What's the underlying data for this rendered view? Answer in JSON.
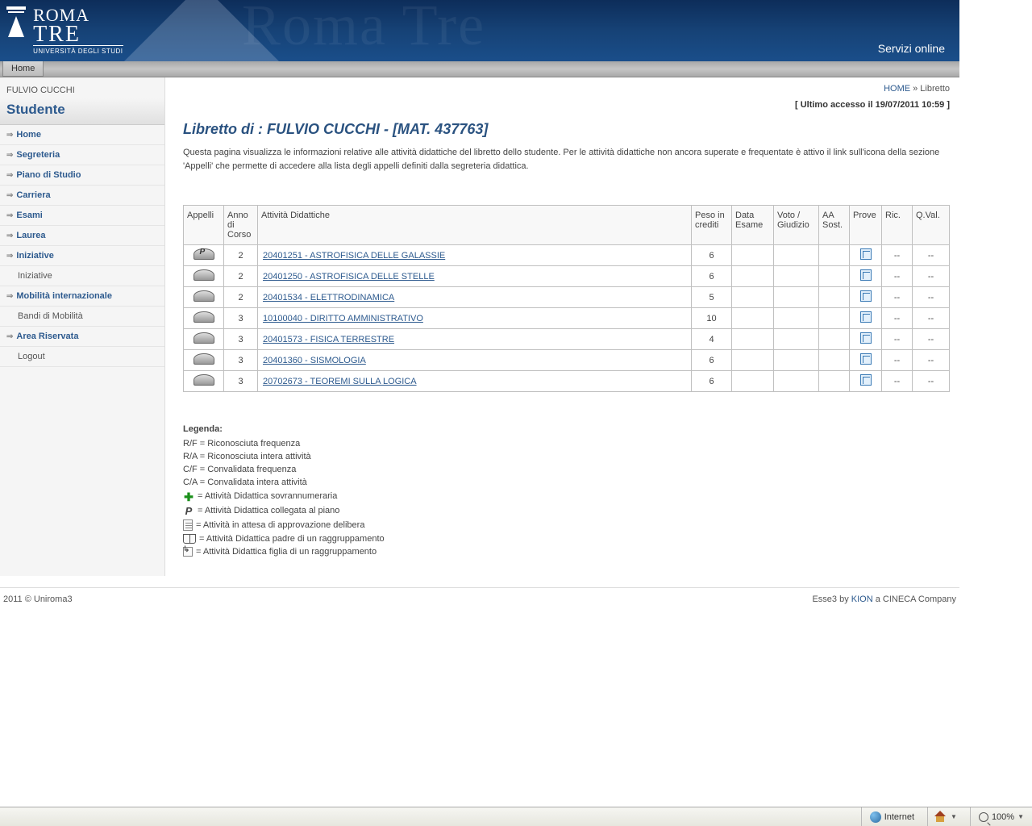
{
  "header": {
    "logo_top": "ROMA",
    "logo_bottom": "TRE",
    "logo_sub": "UNIVERSITÀ DEGLI STUDI",
    "watermark": "Roma Tre",
    "servizi": "Servizi online"
  },
  "topbar": {
    "home": "Home"
  },
  "sidebar": {
    "username": "FULVIO CUCCHI",
    "role": "Studente",
    "items": [
      {
        "label": "Home",
        "type": "main"
      },
      {
        "label": "Segreteria",
        "type": "main"
      },
      {
        "label": "Piano di Studio",
        "type": "main"
      },
      {
        "label": "Carriera",
        "type": "main"
      },
      {
        "label": "Esami",
        "type": "main"
      },
      {
        "label": "Laurea",
        "type": "main"
      },
      {
        "label": "Iniziative",
        "type": "main"
      },
      {
        "label": "Iniziative",
        "type": "sub"
      },
      {
        "label": "Mobilità internazionale",
        "type": "main"
      },
      {
        "label": "Bandi di Mobilità",
        "type": "sub"
      },
      {
        "label": "Area Riservata",
        "type": "main"
      },
      {
        "label": "Logout",
        "type": "sub"
      }
    ]
  },
  "breadcrumb": {
    "home": "HOME",
    "sep": " » ",
    "current": "Libretto"
  },
  "last_access": "[ Ultimo accesso il 19/07/2011 10:59 ]",
  "page_title": "Libretto di : FULVIO CUCCHI - [MAT. 437763]",
  "intro": "Questa pagina visualizza le informazioni relative alle attività didattiche del libretto dello studente. Per le attività didattiche non ancora superate e frequentate è attivo il link sull'icona della sezione 'Appelli' che permette di accedere alla lista degli appelli definiti dalla segreteria didattica.",
  "table": {
    "headers": {
      "appelli": "Appelli",
      "anno": "Anno di Corso",
      "attivita": "Attività Didattiche",
      "peso": "Peso in crediti",
      "data": "Data Esame",
      "voto": "Voto / Giudizio",
      "aa": "AA Sost.",
      "prove": "Prove",
      "ric": "Ric.",
      "qval": "Q.Val."
    },
    "rows": [
      {
        "anno": "2",
        "attivita": "20401251 - ASTROFISICA DELLE GALASSIE",
        "peso": "6",
        "ric": "--",
        "qval": "--",
        "p": true
      },
      {
        "anno": "2",
        "attivita": "20401250 - ASTROFISICA DELLE STELLE",
        "peso": "6",
        "ric": "--",
        "qval": "--",
        "p": false
      },
      {
        "anno": "2",
        "attivita": "20401534 - ELETTRODINAMICA",
        "peso": "5",
        "ric": "--",
        "qval": "--",
        "p": false
      },
      {
        "anno": "3",
        "attivita": "10100040 - DIRITTO AMMINISTRATIVO",
        "peso": "10",
        "ric": "--",
        "qval": "--",
        "p": false
      },
      {
        "anno": "3",
        "attivita": "20401573 - FISICA TERRESTRE",
        "peso": "4",
        "ric": "--",
        "qval": "--",
        "p": false
      },
      {
        "anno": "3",
        "attivita": "20401360 - SISMOLOGIA",
        "peso": "6",
        "ric": "--",
        "qval": "--",
        "p": false
      },
      {
        "anno": "3",
        "attivita": "20702673 - TEOREMI SULLA LOGICA",
        "peso": "6",
        "ric": "--",
        "qval": "--",
        "p": false
      }
    ]
  },
  "legenda": {
    "title": "Legenda:",
    "rf": "R/F = Riconosciuta frequenza",
    "ra": "R/A = Riconosciuta intera attività",
    "cf": "C/F = Convalidata frequenza",
    "ca": "C/A = Convalidata intera attività",
    "sovrannumeraria": "= Attività Didattica sovrannumeraria",
    "collegata": "= Attività Didattica collegata al piano",
    "attesa": "= Attività in attesa di approvazione delibera",
    "padre": "= Attività Didattica padre di un raggruppamento",
    "figlia": "= Attività Didattica figlia di un raggruppamento"
  },
  "footer": {
    "left": "2011 © Uniroma3",
    "right_prefix": "Esse3 by ",
    "kion": "KION",
    "right_suffix": " a CINECA Company"
  },
  "statusbar": {
    "internet": "Internet",
    "zoom": "100%"
  }
}
